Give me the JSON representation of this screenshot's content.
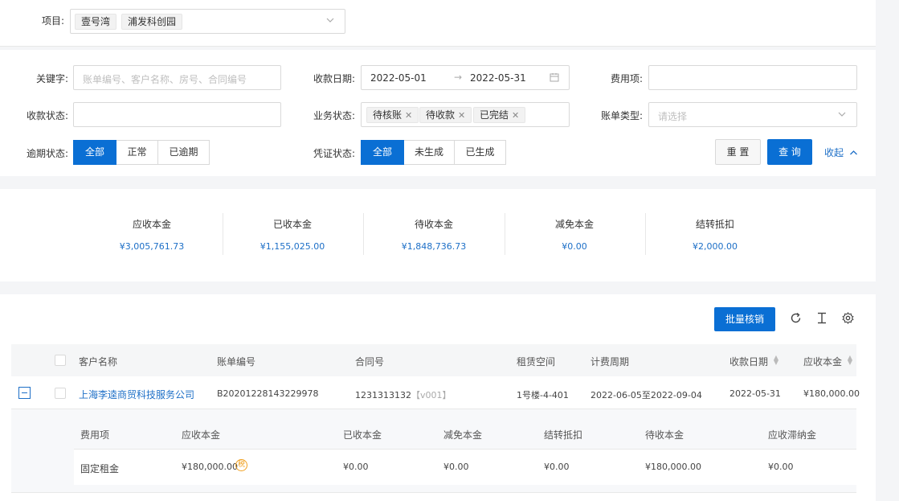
{
  "project": {
    "label": "项目:",
    "tags": [
      "壹号湾",
      "浦发科创园"
    ]
  },
  "filters": {
    "keyword": {
      "label": "关键字:",
      "placeholder": "账单编号、客户名称、房号、合同编号"
    },
    "collect_date": {
      "label": "收款日期:",
      "start": "2022-05-01",
      "arrow": "→",
      "end": "2022-05-31"
    },
    "fee_item": {
      "label": "费用项:"
    },
    "collect_status": {
      "label": "收款状态:"
    },
    "biz_status": {
      "label": "业务状态:",
      "tags": [
        "待核账",
        "待收款",
        "已完结"
      ]
    },
    "bill_type": {
      "label": "账单类型:",
      "placeholder": "请选择"
    },
    "overdue_status": {
      "label": "逾期状态:",
      "options": [
        "全部",
        "正常",
        "已逾期"
      ],
      "selected": 0
    },
    "voucher_status": {
      "label": "凭证状态:",
      "options": [
        "全部",
        "未生成",
        "已生成"
      ],
      "selected": 0
    },
    "reset_label": "重 置",
    "search_label": "查 询",
    "collapse_label": "收起"
  },
  "stats": [
    {
      "label": "应收本金",
      "value": "¥3,005,761.73"
    },
    {
      "label": "已收本金",
      "value": "¥1,155,025.00"
    },
    {
      "label": "待收本金",
      "value": "¥1,848,736.73"
    },
    {
      "label": "减免本金",
      "value": "¥0.00"
    },
    {
      "label": "结转抵扣",
      "value": "¥2,000.00"
    }
  ],
  "toolbar": {
    "batch_label": "批量核销"
  },
  "table": {
    "headers": [
      "客户名称",
      "账单编号",
      "合同号",
      "租赁空间",
      "计费周期",
      "收款日期",
      "应收本金"
    ],
    "row": {
      "customer": "上海李逵商贸科技服务公司",
      "bill_no": "B20201228143229978",
      "contract_no": "1231313132",
      "contract_ver": "【v001】",
      "space": "1号楼-4-401",
      "period": "2022-06-05至2022-09-04",
      "collect_date": "2022-05-31",
      "receivable": "¥180,000.00"
    },
    "sub_headers": [
      "费用项",
      "应收本金",
      "已收本金",
      "减免本金",
      "结转抵扣",
      "待收本金",
      "应收滞纳金"
    ],
    "sub_row": {
      "fee_item": "固定租金",
      "receivable": "¥180,000.00",
      "tax_badge": "税",
      "received": "¥0.00",
      "reduced": "¥0.00",
      "carried": "¥0.00",
      "pending": "¥180,000.00",
      "late_fee": "¥0.00"
    }
  },
  "colors": {
    "primary": "#0a6fd4",
    "link": "#1d6fc7",
    "badge": "#f0a020"
  }
}
